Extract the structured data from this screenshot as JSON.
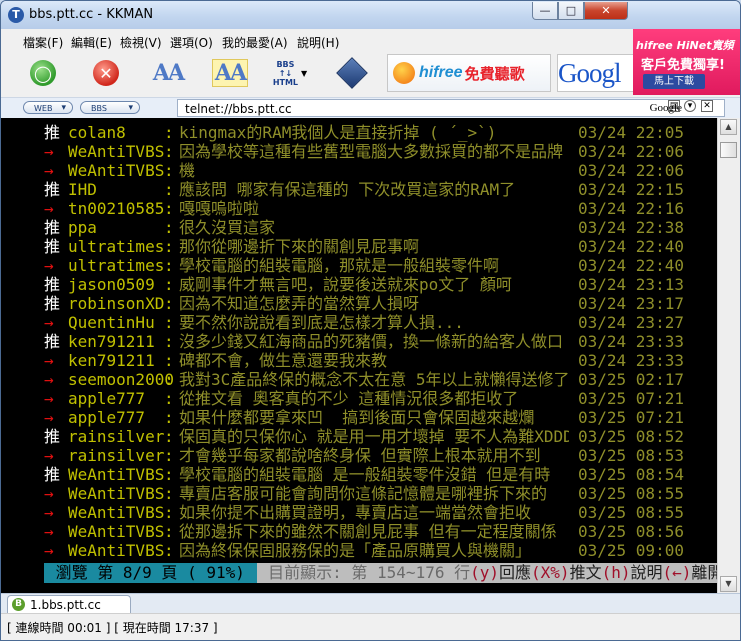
{
  "window": {
    "title": "bbs.ptt.cc - KKMAN",
    "app_icon": "T",
    "minimize": "—",
    "maximize": "□",
    "close": "✕"
  },
  "menu": [
    "檔案(F)",
    "編輯(E)",
    "檢視(V)",
    "選項(O)",
    "我的最愛(A)",
    "說明(H)"
  ],
  "toolbar": {
    "bbs_html_label": "BBS\n↑↓\nHTML",
    "hifree_brand": "hifree",
    "hifree_text": "免費聽歌",
    "google_text": "Googl"
  },
  "ad": {
    "brand": "hifree HiNet寬頻",
    "line": "客戶免費獨享!",
    "button": "馬上下載"
  },
  "address": {
    "web_label": "WEB",
    "bbs_label": "BBS",
    "url": "telnet://bbs.ptt.cc",
    "search_engine": "Google"
  },
  "terminal": {
    "rows": [
      {
        "tag": "推",
        "id": "colan8",
        "text": "kingmax的RAM我個人是直接折掉 ( ´_>`)",
        "time": "03/24 22:05"
      },
      {
        "tag": "→",
        "id": "WeAntiTVBS",
        "text": "因為學校等這種有些舊型電腦大多數採買的都不是品牌",
        "time": "03/24 22:06"
      },
      {
        "tag": "→",
        "id": "WeAntiTVBS",
        "text": "機",
        "time": "03/24 22:06"
      },
      {
        "tag": "推",
        "id": "IHD",
        "text": "應該問 哪家有保這種的 下次改買這家的RAM了",
        "time": "03/24 22:15"
      },
      {
        "tag": "→",
        "id": "tn00210585",
        "text": "嘎嘎嗚啦啦",
        "time": "03/24 22:16"
      },
      {
        "tag": "推",
        "id": "ppa",
        "text": "很久沒買這家",
        "time": "03/24 22:38"
      },
      {
        "tag": "推",
        "id": "ultratimes",
        "text": "那你從哪邊折下來的關創見屁事啊",
        "time": "03/24 22:40"
      },
      {
        "tag": "→",
        "id": "ultratimes",
        "text": "學校電腦的組裝電腦，那就是一般組裝零件啊",
        "time": "03/24 22:40"
      },
      {
        "tag": "推",
        "id": "jason0509",
        "text": "威剛事件才無言吧，說要後送就來po文了 顏呵",
        "time": "03/24 23:13"
      },
      {
        "tag": "推",
        "id": "robinsonXD",
        "text": "因為不知道怎麼弄的當然算人損呀",
        "time": "03/24 23:17"
      },
      {
        "tag": "→",
        "id": "QuentinHu",
        "text": "要不然你說說看到底是怎樣才算人損...",
        "time": "03/24 23:27"
      },
      {
        "tag": "推",
        "id": "ken791211",
        "text": "沒多少錢又紅海商品的死豬價，換一條新的給客人做口",
        "time": "03/24 23:33"
      },
      {
        "tag": "→",
        "id": "ken791211",
        "text": "碑都不會，做生意還要我來教",
        "time": "03/24 23:33"
      },
      {
        "tag": "→",
        "id": "seemoon2000",
        "text": "我對3C產品終保的概念不太在意 5年以上就懶得送修了",
        "time": "03/25 02:17"
      },
      {
        "tag": "→",
        "id": "apple777",
        "text": "從推文看 奧客真的不少 這種情況很多都拒收了",
        "time": "03/25 07:21"
      },
      {
        "tag": "→",
        "id": "apple777",
        "text": "如果什麼都要拿來凹  搞到後面只會保固越來越爛",
        "time": "03/25 07:21"
      },
      {
        "tag": "推",
        "id": "rainsilver",
        "text": "保固真的只保你心 就是用一用才壞掉 要不人為難XDDD",
        "time": "03/25 08:52"
      },
      {
        "tag": "→",
        "id": "rainsilver",
        "text": "才會幾乎每家都說啥終身保 但實際上根本就用不到",
        "time": "03/25 08:53"
      },
      {
        "tag": "推",
        "id": "WeAntiTVBS",
        "text": "學校電腦的組裝電腦 是一般組裝零件沒錯 但是有時",
        "time": "03/25 08:54"
      },
      {
        "tag": "→",
        "id": "WeAntiTVBS",
        "text": "專賣店客服可能會詢問你這條記憶體是哪裡拆下來的",
        "time": "03/25 08:55"
      },
      {
        "tag": "→",
        "id": "WeAntiTVBS",
        "text": "如果你提不出購買證明，專賣店這一端當然會拒收",
        "time": "03/25 08:55"
      },
      {
        "tag": "→",
        "id": "WeAntiTVBS",
        "text": "從那邊拆下來的雖然不關創見屁事 但有一定程度關係",
        "time": "03/25 08:56"
      },
      {
        "tag": "→",
        "id": "WeAntiTVBS",
        "text": "因為終保保固服務保的是「產品原購買人與機關」",
        "time": "03/25 09:00"
      }
    ],
    "status": {
      "browse": " 瀏覽 第 8/9 頁 ( 91%) ",
      "range": " 目前顯示: 第 154~176 行",
      "keys": [
        {
          "k": "(y)",
          "t": "回應"
        },
        {
          "k": "(X%)",
          "t": "推文"
        },
        {
          "k": "(h)",
          "t": "說明"
        },
        {
          "k": "(←)",
          "t": "離開 "
        }
      ]
    }
  },
  "tabs": [
    {
      "label": "1.bbs.ptt.cc",
      "icon": "B"
    }
  ],
  "statusbar": {
    "text": "[ 連線時間 00:01 ] [ 現在時間 17:37 ]"
  }
}
